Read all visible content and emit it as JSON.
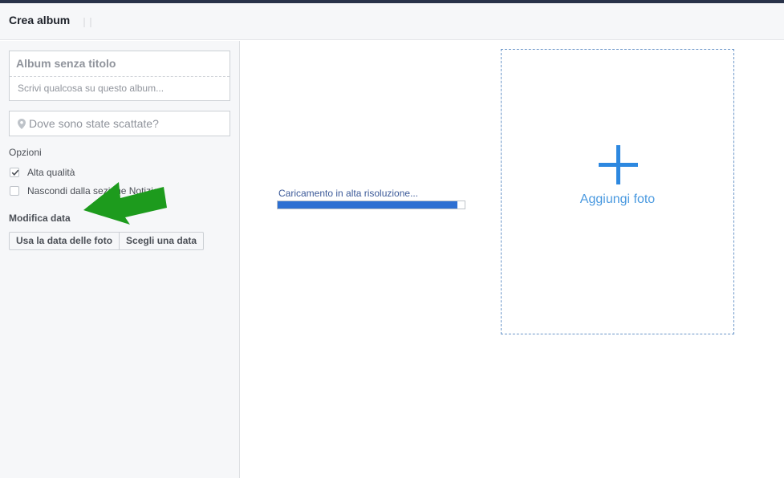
{
  "header": {
    "title": "Crea album"
  },
  "album": {
    "title_placeholder": "Album senza titolo",
    "description_placeholder": "Scrivi qualcosa su questo album..."
  },
  "location": {
    "placeholder": "Dove sono state scattate?",
    "icon": "map-pin-icon"
  },
  "options": {
    "label": "Opzioni",
    "items": [
      {
        "label": "Alta qualità",
        "checked": true
      },
      {
        "label": "Nascondi dalla sezione Notizie",
        "checked": false
      }
    ]
  },
  "date": {
    "label": "Modifica data",
    "buttons": [
      "Usa la data delle foto",
      "Scegli una data"
    ]
  },
  "upload": {
    "status": "Caricamento in alta risoluzione...",
    "progress": 0.96
  },
  "add_photo": {
    "label": "Aggiungi foto",
    "icon": "plus-icon"
  },
  "annotation": {
    "icon": "green-arrow-icon",
    "color": "#1d9b1d"
  },
  "colors": {
    "accent": "#4b9ae0",
    "progress": "#2d6fd2",
    "topbar": "#29334a"
  }
}
